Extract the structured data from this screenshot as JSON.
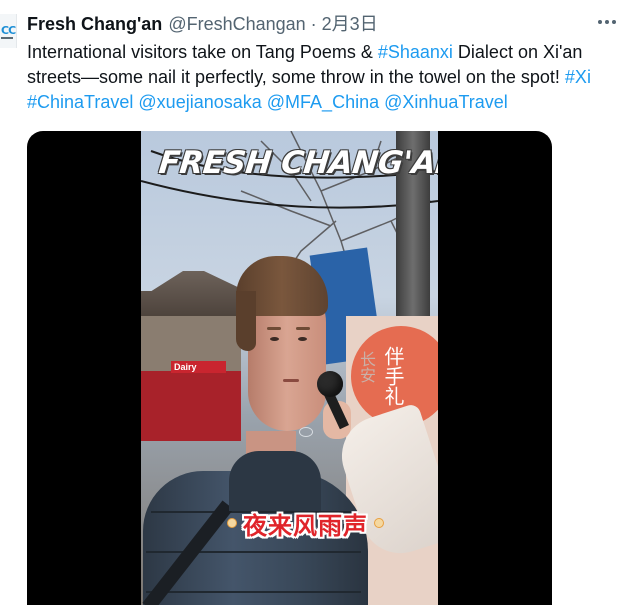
{
  "tweet": {
    "author_name": "Fresh Chang'an",
    "author_handle": "@FreshChangan",
    "separator": "·",
    "date": "2月3日",
    "text_lines": [
      [
        {
          "text": "International visitors take on Tang Poems & ",
          "link": false
        },
        {
          "text": "#Shaanxi",
          "link": true
        },
        {
          "text": " Dialect on Xi'an",
          "link": false
        }
      ],
      [
        {
          "text": "streets—some nail it perfectly, some throw in the towel on the spot! ",
          "link": false
        },
        {
          "text": "#Xi",
          "link": true
        }
      ],
      [
        {
          "text": "#ChinaTravel",
          "link": true
        },
        {
          "text": " ",
          "link": false
        },
        {
          "text": "@xuejianosaka",
          "link": true
        },
        {
          "text": " ",
          "link": false
        },
        {
          "text": "@MFA_China",
          "link": true
        },
        {
          "text": " ",
          "link": false
        },
        {
          "text": "@XinhuaTravel",
          "link": true
        }
      ]
    ]
  },
  "avatar": {
    "label": "CC"
  },
  "video": {
    "title_overlay": "FRESH CHANG'AN",
    "subtitle": "夜来风雨声",
    "poster_text": "伴手礼",
    "poster_text_secondary": "长安",
    "shop_sign": "Dairy"
  },
  "colors": {
    "link": "#1d9bf0",
    "text": "#0f1419",
    "secondary_text": "#536471",
    "subtitle_red": "#e0242a"
  }
}
